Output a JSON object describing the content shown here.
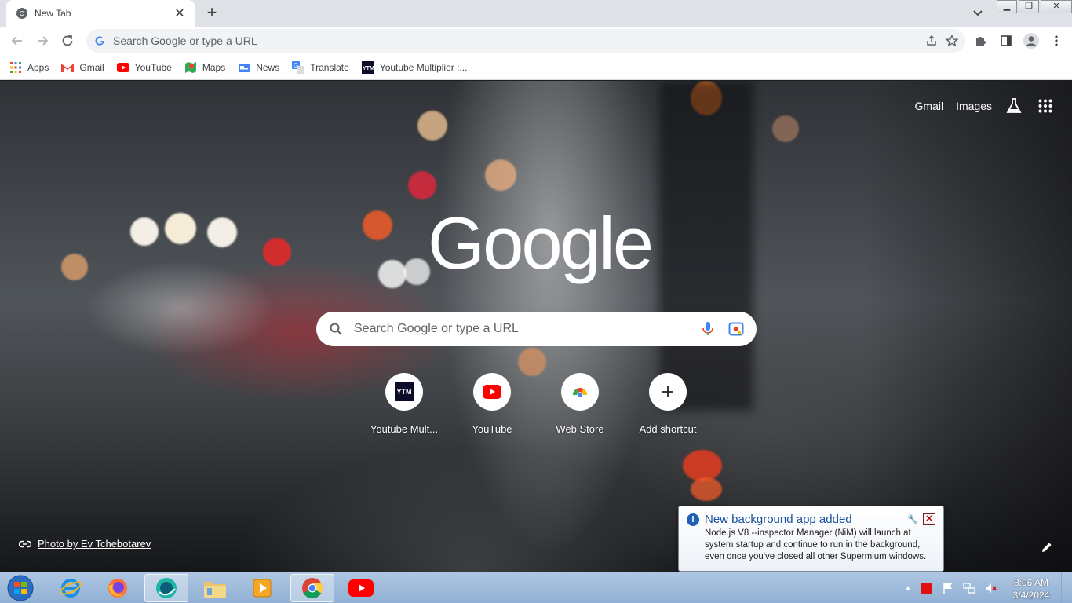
{
  "browser": {
    "tab_title": "New Tab",
    "omnibox_placeholder": "Search Google or type a URL"
  },
  "bookmarks": [
    {
      "label": "Apps"
    },
    {
      "label": "Gmail"
    },
    {
      "label": "YouTube"
    },
    {
      "label": "Maps"
    },
    {
      "label": "News"
    },
    {
      "label": "Translate"
    },
    {
      "label": "Youtube Multiplier :..."
    }
  ],
  "ntp": {
    "gmail_link": "Gmail",
    "images_link": "Images",
    "logo_text": "Google",
    "search_placeholder": "Search Google or type a URL",
    "shortcuts": [
      {
        "label": "Youtube Mult...",
        "tile_text": "YTM"
      },
      {
        "label": "YouTube"
      },
      {
        "label": "Web Store"
      },
      {
        "label": "Add shortcut"
      }
    ],
    "attribution": "Photo by Ev Tchebotarev"
  },
  "notification": {
    "title": "New background app added",
    "body": "Node.js V8 --inspector Manager (NiM) will launch at system startup and continue to run in the background, even once you've closed all other Supermium windows."
  },
  "taskbar": {
    "time": "8:06 AM",
    "date": "3/4/2024"
  },
  "colors": {
    "youtube_red": "#ff0000",
    "google_blue": "#4285f4",
    "notif_title": "#1a4f9c"
  }
}
